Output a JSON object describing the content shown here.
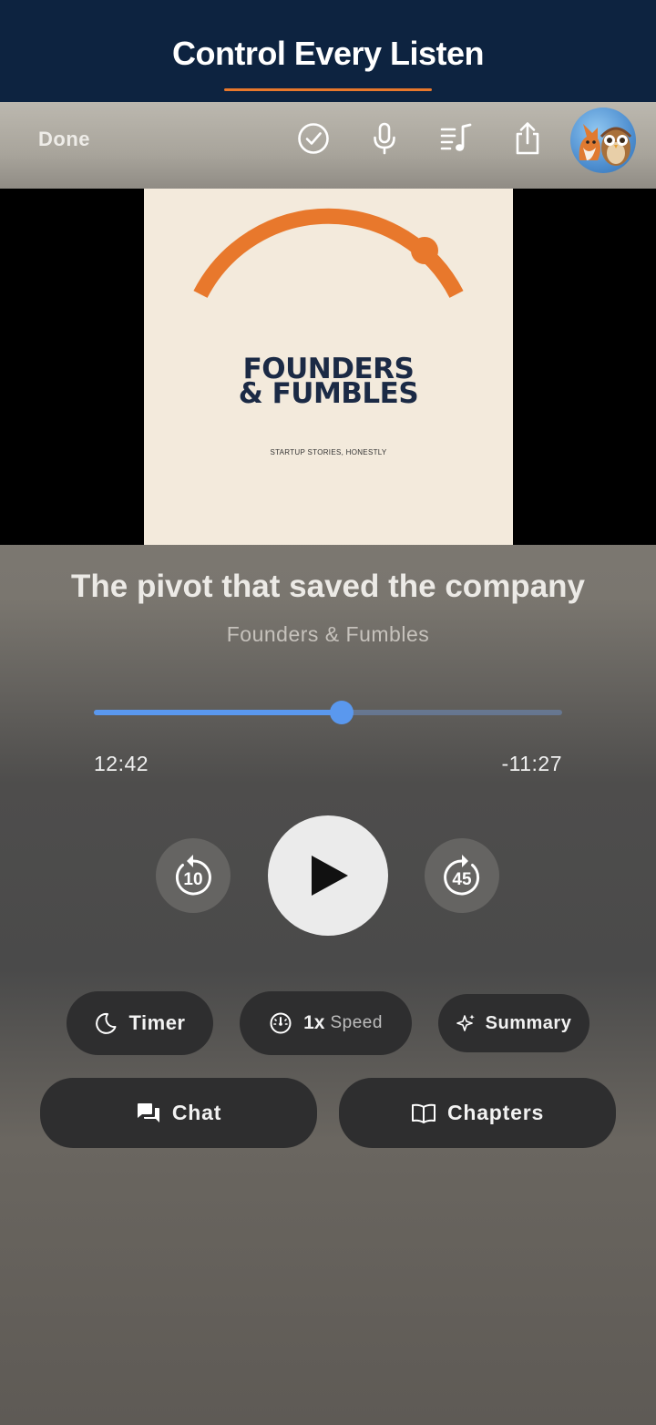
{
  "banner": {
    "title": "Control Every Listen"
  },
  "toolbar": {
    "done_label": "Done",
    "icons": [
      "checkmark-circle-icon",
      "microphone-icon",
      "queue-music-icon",
      "share-icon"
    ]
  },
  "artwork": {
    "title_line1": "FOUNDERS",
    "title_line2": "& FUMBLES",
    "subtitle": "STARTUP STORIES, HONESTLY"
  },
  "episode": {
    "title": "The pivot that saved the company",
    "show": "Founders & Fumbles"
  },
  "progress": {
    "elapsed": "12:42",
    "remaining": "-11:27",
    "fraction": 0.53
  },
  "transport": {
    "skip_back_seconds": "10",
    "skip_forward_seconds": "45"
  },
  "controls": {
    "timer_label": "Timer",
    "speed_value": "1x",
    "speed_label": "Speed",
    "summary_label": "Summary",
    "chat_label": "Chat",
    "chapters_label": "Chapters"
  },
  "colors": {
    "banner_bg": "#0d2340",
    "accent_orange": "#e8782c",
    "progress_blue": "#5a98ee",
    "pill_bg": "#2e2e2f"
  }
}
